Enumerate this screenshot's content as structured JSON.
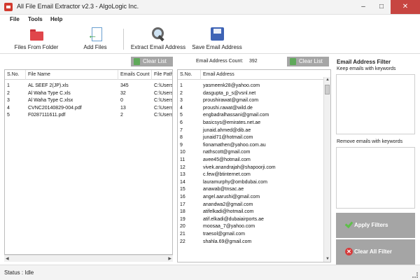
{
  "window": {
    "title": "All File Email Extractor v2.3 - AlgoLogic Inc.",
    "minimize": "–",
    "maximize": "□",
    "close": "✕"
  },
  "menu": [
    "File",
    "Tools",
    "Help"
  ],
  "toolbar": {
    "files_from_folder": "Files From Folder",
    "add_files": "Add Files",
    "extract_email": "Extract Email Address",
    "save_email": "Save Email Address"
  },
  "files_panel": {
    "clear_label": "Clear List",
    "columns": [
      "S.No.",
      "File Name",
      "Emails Count",
      "File Path"
    ],
    "rows": [
      [
        "1",
        "AL SEEF 2(JP).xls",
        "345",
        "C:\\Users"
      ],
      [
        "2",
        "Al Waha Type C.xls",
        "32",
        "C:\\Users"
      ],
      [
        "3",
        "Al Waha Type C.xlsx",
        "0",
        "C:\\Users"
      ],
      [
        "4",
        "CVNC20140829-004.pdf",
        "13",
        "C:\\Users"
      ],
      [
        "5",
        "F0287111611.pdf",
        "2",
        "C:\\Users"
      ]
    ]
  },
  "emails_panel": {
    "count_label": "Email Address Count:",
    "count_value": "392",
    "clear_label": "Clear List",
    "columns": [
      "S.No.",
      "Email Address"
    ],
    "rows": [
      [
        "1",
        "yasmeenk28@yahoo.com"
      ],
      [
        "2",
        "dasgupta_p_s@vsnl.net"
      ],
      [
        "3",
        "proushirawat@gmail.com"
      ],
      [
        "4",
        "proushi.rawat@wild.de"
      ],
      [
        "5",
        "engbadralhassani@gmail.com"
      ],
      [
        "6",
        "basicsys@emirates.net.ae"
      ],
      [
        "7",
        "junaid.ahmed@dib.ae"
      ],
      [
        "8",
        "junaid71@hotmail.com"
      ],
      [
        "9",
        "fionamathen@yahoo.com.au"
      ],
      [
        "10",
        "nathscott@gmail.com"
      ],
      [
        "11",
        "avee45@hotmail.com"
      ],
      [
        "12",
        "vivek.anandrajah@shapoorji.com"
      ],
      [
        "13",
        "c.few@btinternet.com"
      ],
      [
        "14",
        "lauramurphy@ombdubai.com"
      ],
      [
        "15",
        "anawab@tnsac.ae"
      ],
      [
        "16",
        "angel.aarushi@gmail.com"
      ],
      [
        "17",
        "anandwa2@gmail.com"
      ],
      [
        "18",
        "atifelkadi@hotmail.com"
      ],
      [
        "19",
        "atif.elkadi@dubaiairports.ae"
      ],
      [
        "20",
        "moosaa_7@yahoo.com"
      ],
      [
        "21",
        "traesol@gmail.com"
      ],
      [
        "22",
        "shahla.69@gmail.com"
      ]
    ]
  },
  "filter": {
    "title": "Email Address Filter",
    "keep_label": "Keep emails with keywords",
    "remove_label": "Remove emails with keywords",
    "keep_value": "",
    "remove_value": "",
    "apply_label": "Apply Filters",
    "clear_all_label": "Clear All Filter"
  },
  "status": {
    "text": "Status :  Idle"
  }
}
